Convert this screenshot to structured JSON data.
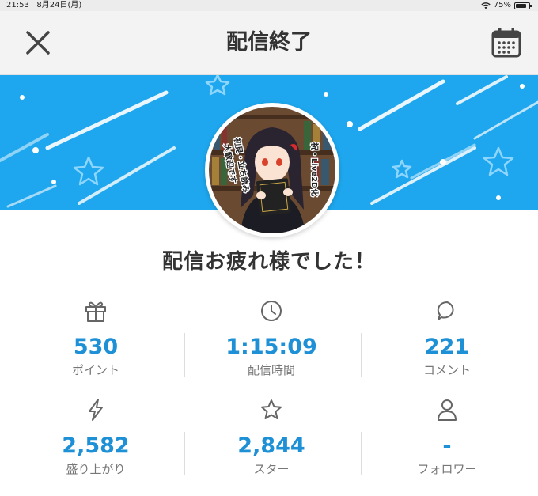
{
  "status": {
    "time": "21:53",
    "date": "8月24日(月)",
    "battery": "75%"
  },
  "header": {
    "title": "配信終了"
  },
  "avatar": {
    "text_right": "祝・Live2D化",
    "text_left_1": "初見・立ち読み",
    "text_left_2": "大歓迎です"
  },
  "message": "配信お疲れ様でした！",
  "stats": {
    "points": {
      "value": "530",
      "label": "ポイント"
    },
    "duration": {
      "value": "1:15:09",
      "label": "配信時間"
    },
    "comments": {
      "value": "221",
      "label": "コメント"
    },
    "excitement": {
      "value": "2,582",
      "label": "盛り上がり"
    },
    "stars": {
      "value": "2,844",
      "label": "スター"
    },
    "followers": {
      "value": "-",
      "label": "フォロワー"
    }
  },
  "colors": {
    "accent": "#1e90d6",
    "banner": "#1ea7ee"
  }
}
